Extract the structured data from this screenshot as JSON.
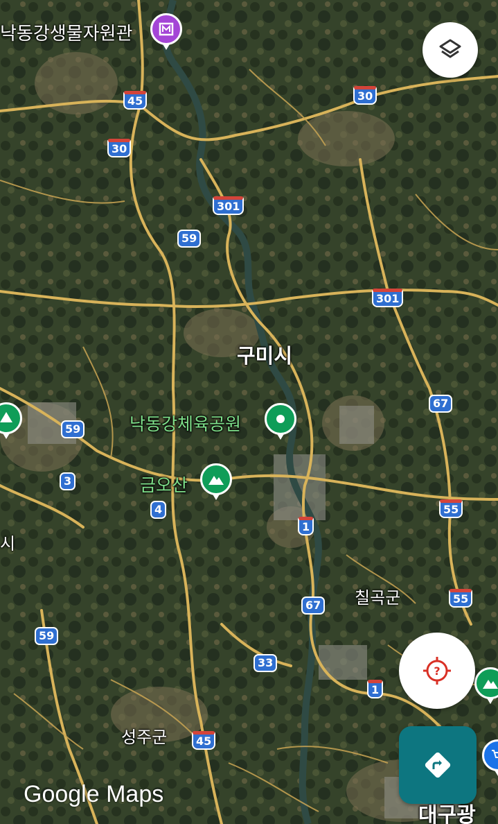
{
  "map": {
    "place_labels": [
      {
        "name": "museum-label",
        "text": "낙동강생물자원관"
      },
      {
        "name": "city-label-gumi",
        "text": "구미시"
      },
      {
        "name": "park-label-nakdonggang",
        "text": "낙동강체육공원"
      },
      {
        "name": "mountain-label-geumosan",
        "text": "금오산"
      },
      {
        "name": "county-label-chilgok",
        "text": "칠곡군"
      },
      {
        "name": "county-label-seongju",
        "text": "성주군"
      },
      {
        "name": "edge-label-si",
        "text": "시"
      },
      {
        "name": "edge-label-daegu",
        "text": "대구광"
      }
    ],
    "road_shields": [
      {
        "name": "route-45-shield-north",
        "text": "45",
        "type": "expressway"
      },
      {
        "name": "route-30-shield-west",
        "text": "30",
        "type": "expressway"
      },
      {
        "name": "route-30-shield-east",
        "text": "30",
        "type": "expressway"
      },
      {
        "name": "route-301-shield-north",
        "text": "301",
        "type": "expressway"
      },
      {
        "name": "route-59-shield-center",
        "text": "59",
        "type": "national"
      },
      {
        "name": "route-301-shield-east",
        "text": "301",
        "type": "expressway"
      },
      {
        "name": "route-67-shield-east",
        "text": "67",
        "type": "national"
      },
      {
        "name": "route-59-shield-west",
        "text": "59",
        "type": "national"
      },
      {
        "name": "route-3-shield",
        "text": "3",
        "type": "national"
      },
      {
        "name": "route-4-shield",
        "text": "4",
        "type": "national"
      },
      {
        "name": "route-1-shield-center",
        "text": "1",
        "type": "expressway"
      },
      {
        "name": "route-55-shield-upper",
        "text": "55",
        "type": "expressway"
      },
      {
        "name": "route-67-shield-center",
        "text": "67",
        "type": "national"
      },
      {
        "name": "route-55-shield-lower",
        "text": "55",
        "type": "expressway"
      },
      {
        "name": "route-59-shield-southwest",
        "text": "59",
        "type": "national"
      },
      {
        "name": "route-33-shield",
        "text": "33",
        "type": "national"
      },
      {
        "name": "route-1-shield-south",
        "text": "1",
        "type": "expressway"
      },
      {
        "name": "route-45-shield-south",
        "text": "45",
        "type": "expressway"
      }
    ],
    "brand": "Google Maps",
    "colors": {
      "museum_pin": "#a445d6",
      "park_pin": "#0f9d58",
      "mountain_pin": "#0f9d58",
      "shield_blue": "#2f6fd1",
      "shield_red": "#d4443a",
      "road": "#d8b35a",
      "river": "#2f4a44",
      "directions_button": "#0d7680",
      "locate_icon": "#d93025"
    }
  },
  "controls": {
    "layers_icon": "layers-icon",
    "locate_icon": "location-unknown-icon",
    "directions_icon": "directions-icon"
  }
}
